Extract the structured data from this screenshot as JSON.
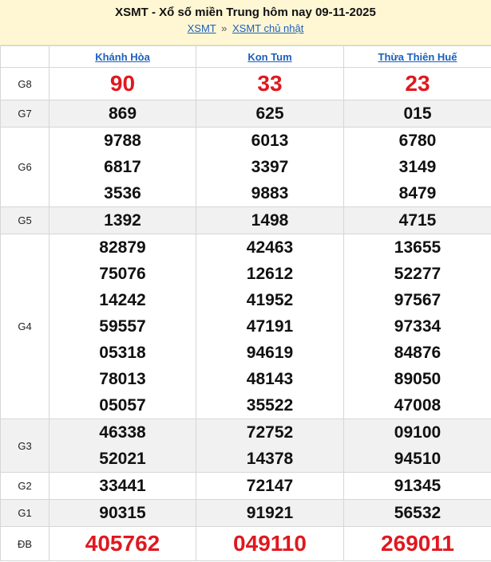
{
  "header": {
    "title": "XSMT - Xổ số miền Trung hôm nay 09-11-2025",
    "breadcrumb": {
      "link1": "XSMT",
      "separator": "»",
      "link2": "XSMT chủ nhật"
    }
  },
  "provinces": [
    "Khánh Hòa",
    "Kon Tum",
    "Thừa Thiên Huế"
  ],
  "prizes": [
    {
      "label": "G8",
      "values": [
        [
          "90"
        ],
        [
          "33"
        ],
        [
          "23"
        ]
      ]
    },
    {
      "label": "G7",
      "values": [
        [
          "869"
        ],
        [
          "625"
        ],
        [
          "015"
        ]
      ]
    },
    {
      "label": "G6",
      "values": [
        [
          "9788",
          "6817",
          "3536"
        ],
        [
          "6013",
          "3397",
          "9883"
        ],
        [
          "6780",
          "3149",
          "8479"
        ]
      ]
    },
    {
      "label": "G5",
      "values": [
        [
          "1392"
        ],
        [
          "1498"
        ],
        [
          "4715"
        ]
      ]
    },
    {
      "label": "G4",
      "values": [
        [
          "82879",
          "75076",
          "14242",
          "59557",
          "05318",
          "78013",
          "05057"
        ],
        [
          "42463",
          "12612",
          "41952",
          "47191",
          "94619",
          "48143",
          "35522"
        ],
        [
          "13655",
          "52277",
          "97567",
          "97334",
          "84876",
          "89050",
          "47008"
        ]
      ]
    },
    {
      "label": "G3",
      "values": [
        [
          "46338",
          "52021"
        ],
        [
          "72752",
          "14378"
        ],
        [
          "09100",
          "94510"
        ]
      ]
    },
    {
      "label": "G2",
      "values": [
        [
          "33441"
        ],
        [
          "72147"
        ],
        [
          "91345"
        ]
      ]
    },
    {
      "label": "G1",
      "values": [
        [
          "90315"
        ],
        [
          "91921"
        ],
        [
          "56532"
        ]
      ]
    },
    {
      "label": "ĐB",
      "values": [
        [
          "405762"
        ],
        [
          "049110"
        ],
        [
          "269011"
        ]
      ]
    }
  ],
  "colors": {
    "highlight": "#e0181f",
    "link": "#1a5fbf",
    "header_bg": "#fff7d4"
  }
}
